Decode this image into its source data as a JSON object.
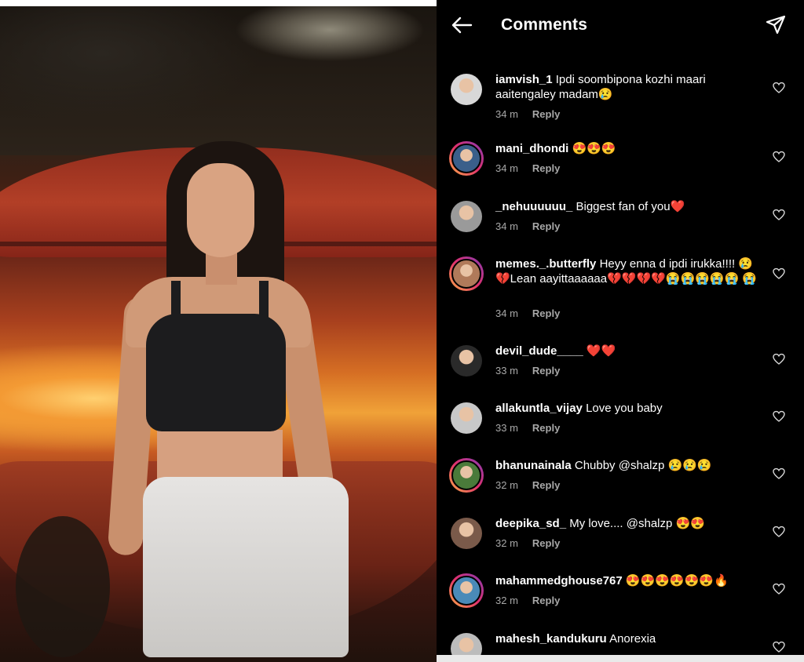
{
  "header": {
    "title": "Comments",
    "back_icon": "arrow-left-icon",
    "share_icon": "paper-plane-icon"
  },
  "comments": [
    {
      "username": "iamvish_1",
      "text": "Ipdi soombipona kozhi maari aaitengaley madam😢",
      "time": "34 m",
      "reply": "Reply",
      "story_ring": false,
      "avatar_color": "#d8d8d8"
    },
    {
      "username": "mani_dhondi",
      "text": "😍😍😍",
      "time": "34 m",
      "reply": "Reply",
      "story_ring": true,
      "avatar_color": "#3a5f8a"
    },
    {
      "username": "_nehuuuuuu_",
      "text": "Biggest fan of you❤️",
      "time": "34 m",
      "reply": "Reply",
      "story_ring": false,
      "avatar_color": "#9a9a9a"
    },
    {
      "username": "memes._.butterfly",
      "text": "Heyy enna d ipdi irukka!!!! 😢💔Lean aayittaaaaaa💔💔💔💔😭😭😭😭😭 😭",
      "time": "34 m",
      "reply": "Reply",
      "story_ring": true,
      "avatar_color": "#b07a5a"
    },
    {
      "username": "devil_dude____",
      "text": "❤️❤️",
      "time": "33 m",
      "reply": "Reply",
      "story_ring": false,
      "avatar_color": "#2a2a2a"
    },
    {
      "username": "allakuntla_vijay",
      "text": "Love you baby",
      "time": "33 m",
      "reply": "Reply",
      "story_ring": false,
      "avatar_color": "#c8c8c8"
    },
    {
      "username": "bhanunainala",
      "text": "Chubby @shalzp 😢😢😢",
      "time": "32 m",
      "reply": "Reply",
      "story_ring": true,
      "avatar_color": "#4a7a3a"
    },
    {
      "username": "deepika_sd_",
      "text": "My love.... @shalzp 😍😍",
      "time": "32 m",
      "reply": "Reply",
      "story_ring": false,
      "avatar_color": "#7a5a4a"
    },
    {
      "username": "mahammedghouse767",
      "text": "😍😍😍😍😍😍🔥",
      "time": "32 m",
      "reply": "Reply",
      "story_ring": true,
      "avatar_color": "#4a8ab8"
    },
    {
      "username": "mahesh_kandukuru",
      "text": "Anorexia",
      "time": "",
      "reply": "",
      "story_ring": false,
      "avatar_color": "#bcbcbc"
    }
  ],
  "colors": {
    "panel_bg": "#000000",
    "muted_text": "#a8a8a8",
    "story_ring_start": "#fcaf45",
    "story_ring_end": "#833ab4"
  }
}
